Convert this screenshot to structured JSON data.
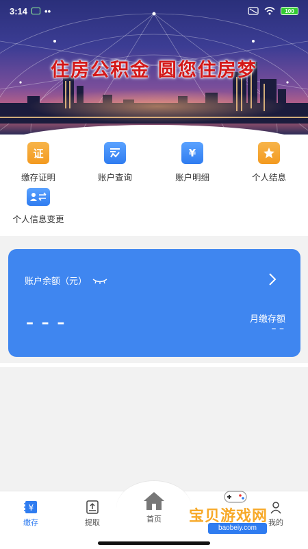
{
  "status_bar": {
    "time": "3:14",
    "dots": "••",
    "battery": "100"
  },
  "banner": {
    "title": "住房公积金  圆您住房梦"
  },
  "menu": {
    "items": [
      {
        "label": "缴存证明",
        "icon": "certificate-icon",
        "glyph": "证"
      },
      {
        "label": "账户查询",
        "icon": "account-query-icon"
      },
      {
        "label": "账户明细",
        "icon": "account-detail-icon",
        "glyph": "¥"
      },
      {
        "label": "个人结息",
        "icon": "interest-icon"
      },
      {
        "label": "个人信息变更",
        "icon": "profile-change-icon"
      }
    ]
  },
  "account_card": {
    "title": "账户余额（元）",
    "balance": "– – –",
    "monthly_label": "月缴存额",
    "monthly_value": "– –"
  },
  "tabbar": {
    "tabs": [
      {
        "label": "缴存",
        "icon": "deposit-icon",
        "glyph": "¥"
      },
      {
        "label": "提取",
        "icon": "withdraw-icon"
      },
      {
        "label": "首页",
        "icon": "home-icon"
      },
      {
        "label": "我的",
        "icon": "user-icon"
      }
    ]
  },
  "watermark": {
    "text": "宝贝游戏网",
    "url": "baobeiy.com"
  },
  "colors": {
    "primary": "#3f86f0",
    "accent_orange": "#f39a20",
    "banner_title": "#d41818"
  }
}
